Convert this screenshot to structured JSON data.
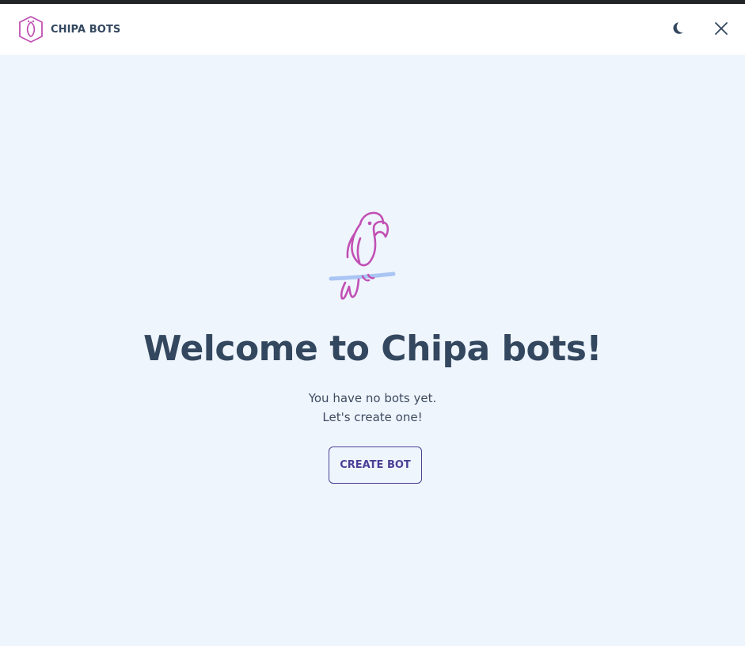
{
  "app": {
    "name": "CHIPA BOTS",
    "logo_icon": "parrot-shield-icon"
  },
  "header": {
    "theme_toggle_icon": "moon-icon",
    "close_icon": "close-icon"
  },
  "empty_state": {
    "illustration": "parrot-illustration",
    "title": "Welcome to Chipa bots!",
    "line1": "You have no bots yet.",
    "line2": "Let's create one!",
    "create_button_label": "CREATE BOT"
  },
  "colors": {
    "background": "#eff5fd",
    "header_background": "#ffffff",
    "text_primary": "#33475f",
    "accent": "#4b3f96",
    "parrot": "#c150b4",
    "perch": "#a9c5f3"
  }
}
